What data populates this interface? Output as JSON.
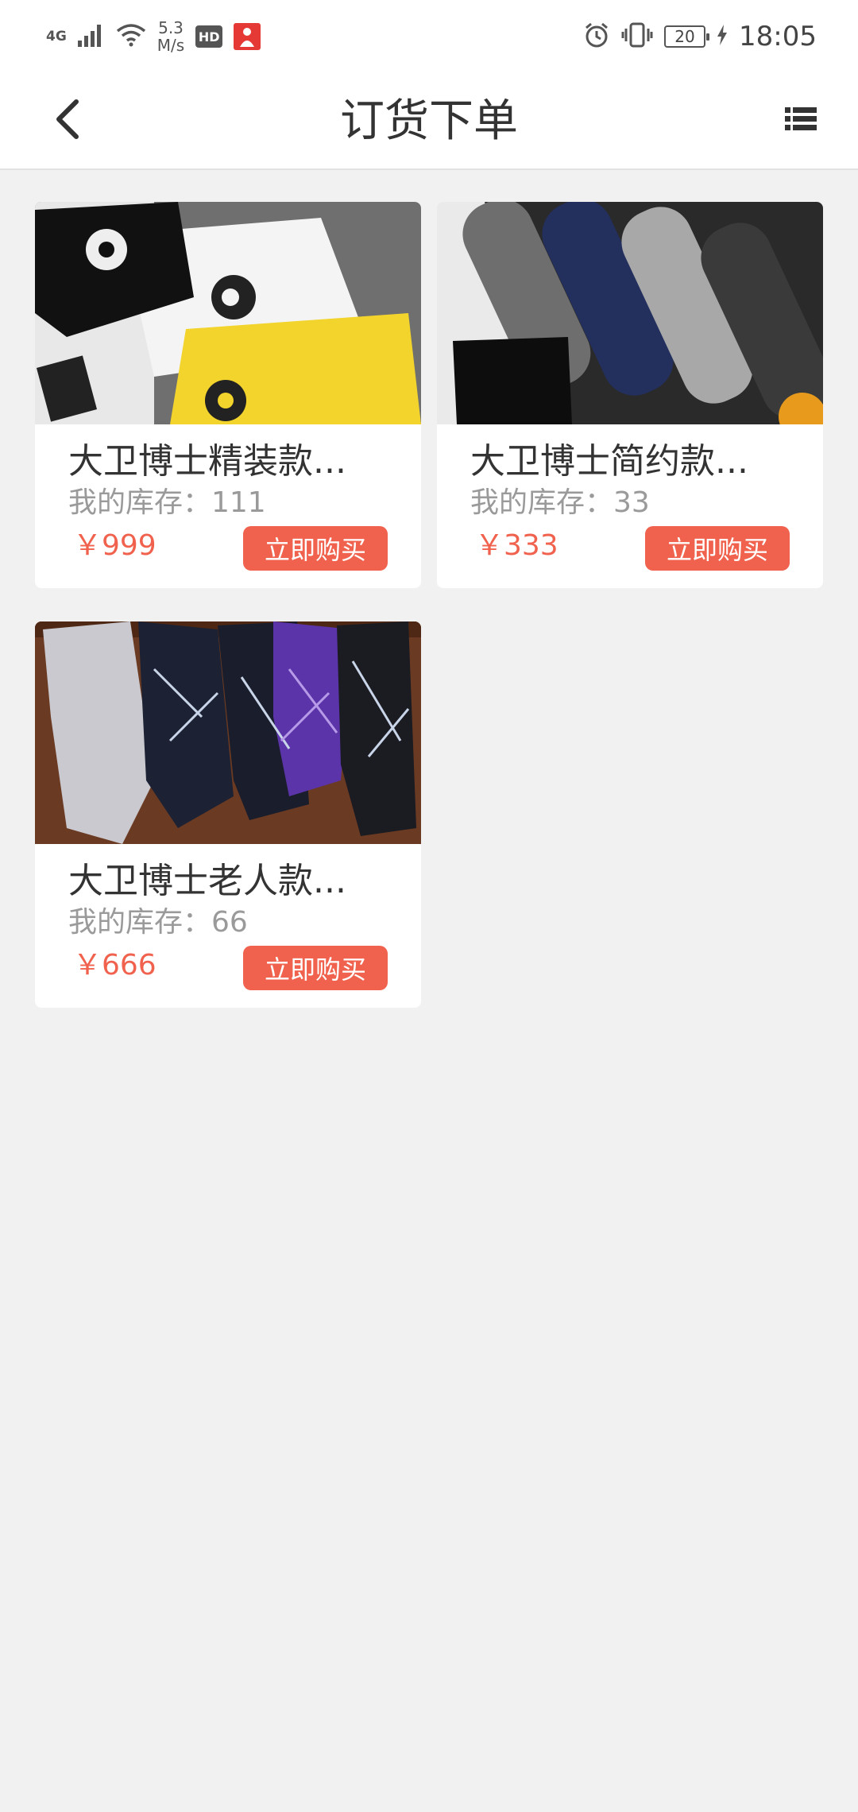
{
  "status_bar": {
    "network": "4G",
    "speed_value": "5.3",
    "speed_unit": "M/s",
    "hd": "HD",
    "battery": "20",
    "time": "18:05"
  },
  "header": {
    "title": "订货下单"
  },
  "products": [
    {
      "name": "大卫博士精装款...",
      "stock": "我的库存：111",
      "price": "￥999",
      "buy_label": "立即购买"
    },
    {
      "name": "大卫博士简约款...",
      "stock": "我的库存：33",
      "price": "￥333",
      "buy_label": "立即购买"
    },
    {
      "name": "大卫博士老人款...",
      "stock": "我的库存：66",
      "price": "￥666",
      "buy_label": "立即购买"
    }
  ],
  "colors": {
    "accent": "#f0624d",
    "background": "#f1f1f1",
    "card": "#ffffff"
  }
}
